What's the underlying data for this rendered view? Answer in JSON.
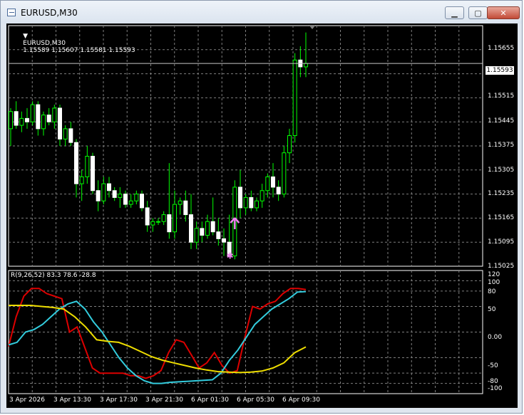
{
  "window": {
    "title": "EURUSD,M30",
    "controls": {
      "minimize": "▁",
      "maximize": "▢",
      "close": "✕"
    }
  },
  "main": {
    "header": {
      "symbol": "EURUSD,M30",
      "ohlc": "1.15589 1.15607 1.15581 1.15593"
    },
    "current_price": "1.15593",
    "price_labels": [
      "1.15655",
      "1.15515",
      "1.15445",
      "1.15375",
      "1.15305",
      "1.15235",
      "1.15165",
      "1.15095",
      "1.15025"
    ]
  },
  "indicator": {
    "header": "R(9,26,52) 83.3 78.6 -28.8",
    "levels": [
      "120",
      "100",
      "80",
      "50",
      "0.00",
      "-50",
      "-80",
      "-100"
    ]
  },
  "time_labels": [
    "3 Apr 2026",
    "3 Apr 13:30",
    "3 Apr 17:30",
    "3 Apr 21:30",
    "6 Apr 01:30",
    "6 Apr 05:30",
    "6 Apr 09:30"
  ],
  "colors": {
    "bull": "#00ff00",
    "bear": "#ffffff",
    "arrow": "#ee82ee",
    "grid": "#7f7f7f",
    "r9": "#dd0000",
    "r26": "#33ccdd",
    "r52": "#eedd00"
  },
  "chart_data": {
    "type": "candlestick",
    "price_range": [
      1.15,
      1.157
    ],
    "candles": [
      [
        1.154,
        1.1546,
        1.1535,
        1.1545
      ],
      [
        1.1545,
        1.1548,
        1.154,
        1.1541
      ],
      [
        1.1541,
        1.1545,
        1.1539,
        1.1543
      ],
      [
        1.1543,
        1.1546,
        1.154,
        1.1542
      ],
      [
        1.1542,
        1.1548,
        1.1541,
        1.1547
      ],
      [
        1.1547,
        1.1548,
        1.1538,
        1.154
      ],
      [
        1.154,
        1.1545,
        1.1538,
        1.1544
      ],
      [
        1.1544,
        1.1546,
        1.1541,
        1.1542
      ],
      [
        1.1542,
        1.1547,
        1.154,
        1.1546
      ],
      [
        1.1546,
        1.1547,
        1.1535,
        1.1537
      ],
      [
        1.1537,
        1.1541,
        1.1535,
        1.154
      ],
      [
        1.154,
        1.1542,
        1.1535,
        1.1536
      ],
      [
        1.1536,
        1.1537,
        1.152,
        1.1524
      ],
      [
        1.1524,
        1.1528,
        1.1519,
        1.1526
      ],
      [
        1.1526,
        1.1535,
        1.1524,
        1.1532
      ],
      [
        1.1532,
        1.1533,
        1.1521,
        1.1522
      ],
      [
        1.1522,
        1.1525,
        1.1516,
        1.1519
      ],
      [
        1.1519,
        1.1526,
        1.1518,
        1.1524
      ],
      [
        1.1524,
        1.1526,
        1.152,
        1.1522
      ],
      [
        1.1522,
        1.1523,
        1.1519,
        1.152
      ],
      [
        1.152,
        1.1523,
        1.1517,
        1.1521
      ],
      [
        1.1521,
        1.1522,
        1.1517,
        1.1518
      ],
      [
        1.1518,
        1.1521,
        1.1517,
        1.1519
      ],
      [
        1.1519,
        1.1522,
        1.1518,
        1.1521
      ],
      [
        1.1521,
        1.1522,
        1.1516,
        1.1517
      ],
      [
        1.1517,
        1.1519,
        1.151,
        1.1512
      ],
      [
        1.1512,
        1.1514,
        1.151,
        1.1513
      ],
      [
        1.1513,
        1.1514,
        1.1512,
        1.1513
      ],
      [
        1.1513,
        1.1516,
        1.1512,
        1.1515
      ],
      [
        1.1515,
        1.153,
        1.1508,
        1.151
      ],
      [
        1.151,
        1.1522,
        1.1508,
        1.1518
      ],
      [
        1.1518,
        1.152,
        1.1515,
        1.1519
      ],
      [
        1.1519,
        1.1522,
        1.1513,
        1.1515
      ],
      [
        1.1515,
        1.1521,
        1.1505,
        1.1507
      ],
      [
        1.1507,
        1.1513,
        1.1505,
        1.1511
      ],
      [
        1.1511,
        1.1513,
        1.1507,
        1.1509
      ],
      [
        1.1509,
        1.1515,
        1.1508,
        1.1513
      ],
      [
        1.1513,
        1.152,
        1.1509,
        1.151
      ],
      [
        1.151,
        1.1514,
        1.1506,
        1.1508
      ],
      [
        1.1508,
        1.1511,
        1.1503,
        1.1507
      ],
      [
        1.1507,
        1.1515,
        1.1505,
        1.1503
      ],
      [
        1.1503,
        1.1525,
        1.1502,
        1.1523
      ],
      [
        1.1523,
        1.1528,
        1.1514,
        1.1517
      ],
      [
        1.1517,
        1.1521,
        1.1515,
        1.152
      ],
      [
        1.152,
        1.1522,
        1.1516,
        1.1517
      ],
      [
        1.1517,
        1.152,
        1.1516,
        1.1519
      ],
      [
        1.1519,
        1.1524,
        1.1517,
        1.1522
      ],
      [
        1.1522,
        1.1527,
        1.152,
        1.1526
      ],
      [
        1.1526,
        1.153,
        1.152,
        1.1523
      ],
      [
        1.1523,
        1.1525,
        1.1519,
        1.1521
      ],
      [
        1.1521,
        1.1535,
        1.152,
        1.1533
      ],
      [
        1.1533,
        1.154,
        1.153,
        1.1538
      ],
      [
        1.1538,
        1.1562,
        1.1536,
        1.156
      ],
      [
        1.156,
        1.1564,
        1.1555,
        1.1558
      ],
      [
        1.1558,
        1.1568,
        1.1555,
        1.1559
      ]
    ],
    "arrow_up": {
      "price": 1.1512
    },
    "star": {
      "price": 1.1503
    },
    "indicator": {
      "range": [
        -120,
        120
      ],
      "levels": [
        100,
        80,
        50,
        0,
        -50,
        -80,
        -100
      ],
      "series": [
        {
          "color": "#dd0000",
          "values": [
            -28,
            30,
            70,
            85,
            85,
            75,
            70,
            65,
            0,
            10,
            -30,
            -70,
            -80,
            -80,
            -80,
            -80,
            -85,
            -85,
            -90,
            -85,
            -75,
            -40,
            -15,
            -20,
            -45,
            -70,
            -60,
            -40,
            -65,
            -80,
            -75,
            -10,
            50,
            45,
            55,
            60,
            75,
            85,
            85,
            83
          ]
        },
        {
          "color": "#33ccdd",
          "values": [
            -25,
            -20,
            0,
            5,
            15,
            30,
            45,
            55,
            60,
            45,
            20,
            0,
            -25,
            -50,
            -70,
            -85,
            -95,
            -100,
            -100,
            -98,
            -97,
            -96,
            -95,
            -94,
            -93,
            -80,
            -55,
            -35,
            -10,
            15,
            30,
            45,
            55,
            65,
            78,
            79
          ]
        },
        {
          "color": "#eedd00",
          "values": [
            52,
            52,
            52,
            50,
            48,
            45,
            30,
            10,
            -15,
            -18,
            -20,
            -28,
            -38,
            -48,
            -55,
            -60,
            -65,
            -70,
            -74,
            -77,
            -78,
            -79,
            -78,
            -76,
            -70,
            -60,
            -40,
            -29
          ]
        }
      ]
    }
  }
}
